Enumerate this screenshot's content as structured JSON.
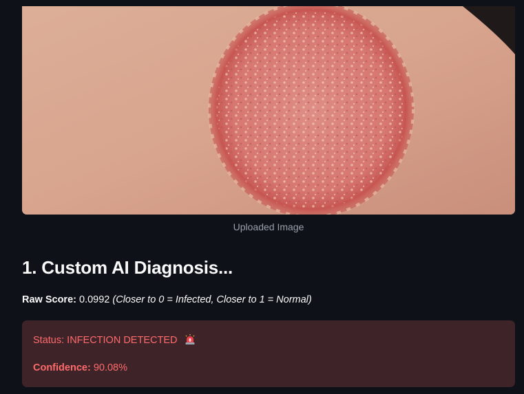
{
  "uploaded_image": {
    "caption": "Uploaded Image"
  },
  "diagnosis": {
    "heading": "1. Custom AI Diagnosis...",
    "raw_score_label": "Raw Score:",
    "raw_score_value": "0.0992",
    "raw_score_note": "(Closer to 0 = Infected, Closer to 1 = Normal)"
  },
  "result_alert": {
    "status_text": "Status: INFECTION DETECTED",
    "status_icon": "siren-icon",
    "confidence_label": "Confidence:",
    "confidence_value": "90.08%"
  },
  "colors": {
    "background": "#0e1117",
    "alert_background": "#3e2328",
    "alert_text": "#ff6b6b"
  }
}
